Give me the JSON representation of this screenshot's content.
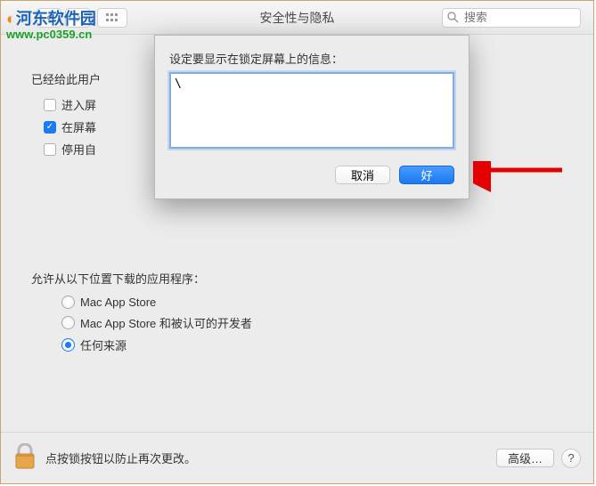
{
  "titlebar": {
    "title": "安全性与隐私",
    "search_placeholder": "搜索"
  },
  "section1": {
    "label": "已经给此用户",
    "cb1": {
      "checked": false,
      "label": "进入屏"
    },
    "cb2": {
      "checked": true,
      "label": "在屏幕"
    },
    "cb3": {
      "checked": false,
      "label": "停用自"
    }
  },
  "section2": {
    "label": "允许从以下位置下载的应用程序：",
    "opt1": {
      "selected": false,
      "label": "Mac App Store"
    },
    "opt2": {
      "selected": false,
      "label": "Mac App Store 和被认可的开发者"
    },
    "opt3": {
      "selected": true,
      "label": "任何来源"
    }
  },
  "footer": {
    "text": "点按锁按钮以防止再次更改。",
    "advanced": "高级…",
    "help": "?"
  },
  "dialog": {
    "label": "设定要显示在锁定屏幕上的信息：",
    "value": "\\",
    "cancel": "取消",
    "ok": "好"
  },
  "watermark": {
    "text": "河东软件园",
    "url": "www.pc0359.cn"
  }
}
